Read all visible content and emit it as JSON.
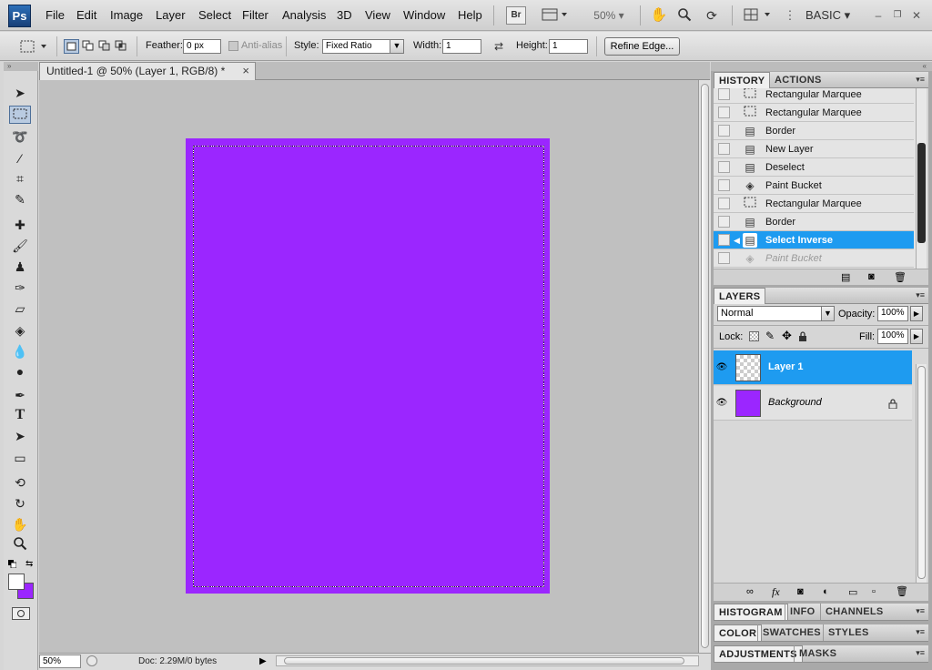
{
  "app": {
    "logo": "Ps"
  },
  "menu": [
    "File",
    "Edit",
    "Image",
    "Layer",
    "Select",
    "Filter",
    "Analysis",
    "3D",
    "View",
    "Window",
    "Help"
  ],
  "menubar_right": {
    "br_label": "Br",
    "zoom": "50%",
    "workspace": "BASIC",
    "minimize_glyph": "–",
    "restore_glyph": "❐",
    "close_glyph": "✕"
  },
  "options": {
    "feather_label": "Feather:",
    "feather_value": "0 px",
    "antialias_label": "Anti-alias",
    "style_label": "Style:",
    "style_value": "Fixed Ratio",
    "width_label": "Width:",
    "width_value": "1",
    "height_label": "Height:",
    "height_value": "1",
    "refine_label": "Refine Edge..."
  },
  "document": {
    "tab_title": "Untitled-1 @ 50% (Layer 1, RGB/8) *",
    "close_glyph": "×",
    "canvas_color": "#9b26ff"
  },
  "status": {
    "zoom": "50%",
    "doc_info": "Doc: 2.29M/0 bytes"
  },
  "history": {
    "tabs": [
      "HISTORY",
      "ACTIONS"
    ],
    "items": [
      {
        "label": "Rectangular Marquee",
        "icon": "marquee-icon"
      },
      {
        "label": "Rectangular Marquee",
        "icon": "marquee-icon"
      },
      {
        "label": "Border",
        "icon": "document-icon"
      },
      {
        "label": "New Layer",
        "icon": "document-icon"
      },
      {
        "label": "Deselect",
        "icon": "document-icon"
      },
      {
        "label": "Paint Bucket",
        "icon": "paint-bucket-icon"
      },
      {
        "label": "Rectangular Marquee",
        "icon": "marquee-icon"
      },
      {
        "label": "Border",
        "icon": "document-icon"
      },
      {
        "label": "Select Inverse",
        "icon": "document-icon",
        "selected": true
      },
      {
        "label": "Paint Bucket",
        "icon": "paint-bucket-icon",
        "ghost": true
      }
    ]
  },
  "layers": {
    "tab": "LAYERS",
    "blend_mode": "Normal",
    "opacity_label": "Opacity:",
    "opacity_value": "100%",
    "lock_label": "Lock:",
    "fill_label": "Fill:",
    "fill_value": "100%",
    "items": [
      {
        "name": "Layer 1",
        "selected": true
      },
      {
        "name": "Background",
        "locked": true
      }
    ]
  },
  "collapsed_panels": [
    [
      "HISTOGRAM",
      "INFO",
      "CHANNELS"
    ],
    [
      "COLOR",
      "SWATCHES",
      "STYLES"
    ],
    [
      "ADJUSTMENTS",
      "MASKS"
    ]
  ],
  "colors": {
    "accent": "#1e9bf0",
    "foreground": "#ffffff",
    "background": "#9b26ff"
  }
}
